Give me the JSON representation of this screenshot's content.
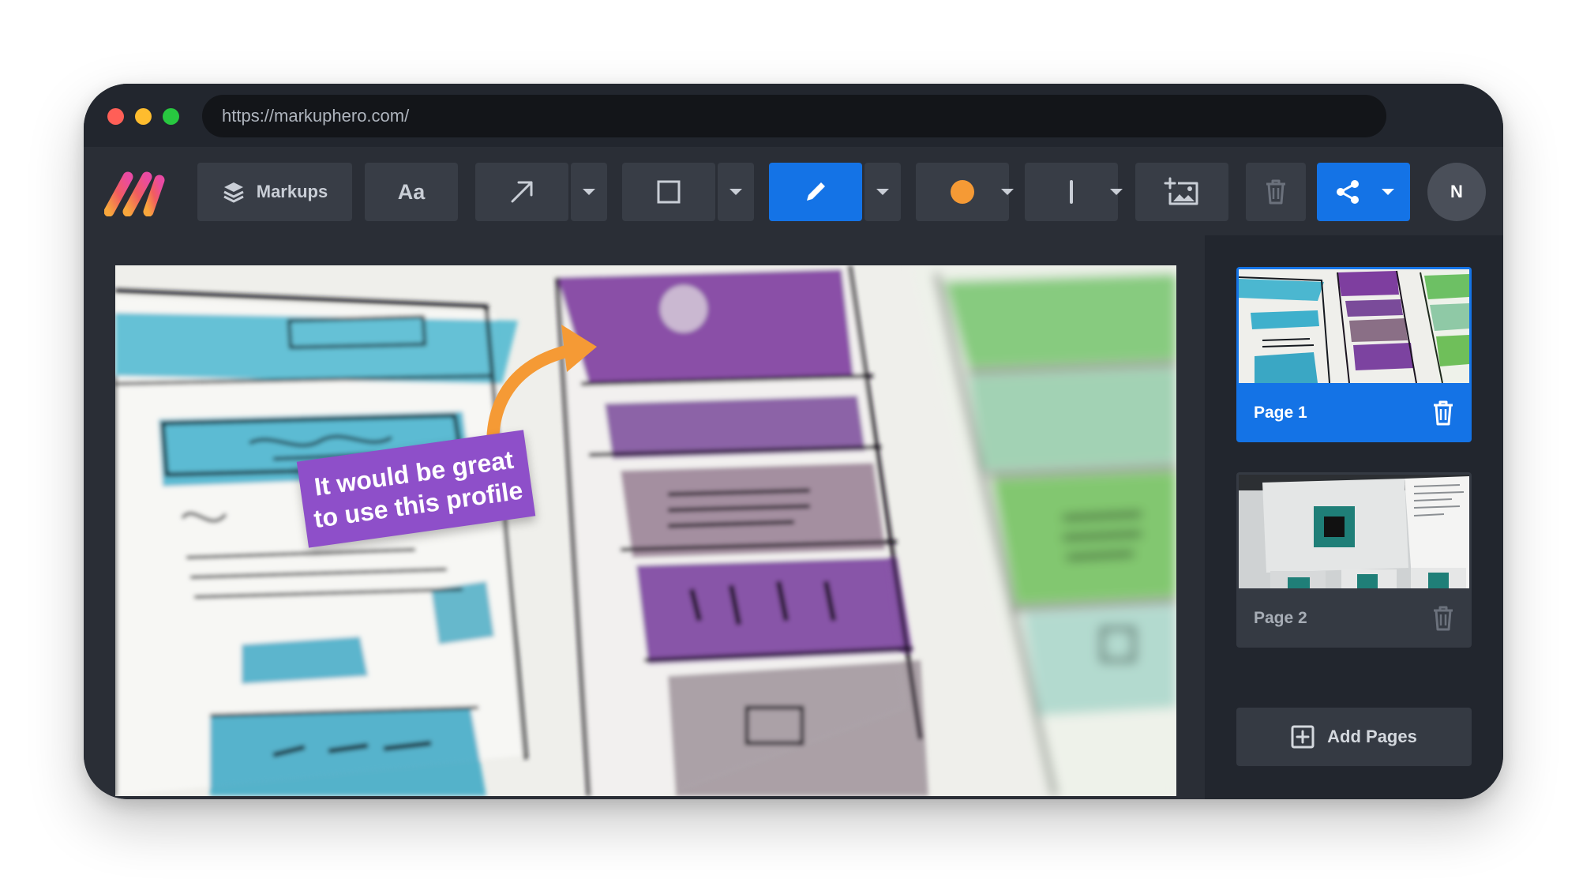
{
  "browser": {
    "url": "https://markuphero.com/"
  },
  "toolbar": {
    "markups_label": "Markups",
    "text_tool_label": "Aa",
    "color_accent": "#1473e6",
    "current_color": "#f59a35",
    "avatar_initial": "N"
  },
  "canvas": {
    "note_text_line1": "It would be great",
    "note_text_line2": "to use this profile",
    "note_color": "#8e4fc9",
    "arrow_color": "#f59a35"
  },
  "pages": {
    "items": [
      {
        "label": "Page 1",
        "selected": true
      },
      {
        "label": "Page 2",
        "selected": false
      }
    ],
    "add_label": "Add Pages"
  }
}
